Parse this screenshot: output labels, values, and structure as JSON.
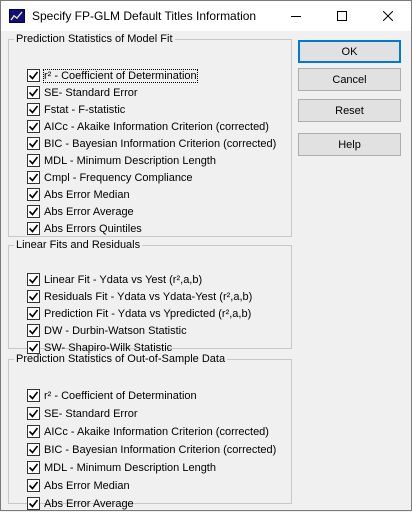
{
  "window": {
    "title": "Specify FP-GLM Default Titles Information"
  },
  "groups": {
    "model_fit": {
      "legend": "Prediction Statistics of Model Fit",
      "items": [
        {
          "label": "r² - Coefficient of Determination",
          "checked": true
        },
        {
          "label": "SE- Standard Error",
          "checked": true
        },
        {
          "label": "Fstat - F-statistic",
          "checked": true
        },
        {
          "label": "AICc - Akaike Information Criterion (corrected)",
          "checked": true
        },
        {
          "label": "BIC - Bayesian Information Criterion (corrected)",
          "checked": true
        },
        {
          "label": "MDL - Minimum Description Length",
          "checked": true
        },
        {
          "label": "Cmpl - Frequency Compliance",
          "checked": true
        },
        {
          "label": "Abs Error Median",
          "checked": true
        },
        {
          "label": "Abs Error Average",
          "checked": true
        },
        {
          "label": "Abs Errors Quintiles",
          "checked": true
        }
      ]
    },
    "linear_fits": {
      "legend": "Linear Fits and Residuals",
      "items": [
        {
          "label": "Linear Fit - Ydata vs Yest (r²,a,b)",
          "checked": true
        },
        {
          "label": "Residuals Fit - Ydata vs Ydata-Yest (r²,a,b)",
          "checked": true
        },
        {
          "label": "Prediction Fit - Ydata vs Ypredicted (r²,a,b)",
          "checked": true
        },
        {
          "label": "DW - Durbin-Watson Statistic",
          "checked": true
        },
        {
          "label": "SW- Shapiro-Wilk Statistic",
          "checked": true
        }
      ]
    },
    "out_of_sample": {
      "legend": "Prediction Statistics of Out-of-Sample Data",
      "items": [
        {
          "label": "r² - Coefficient of Determination",
          "checked": true
        },
        {
          "label": "SE- Standard Error",
          "checked": true
        },
        {
          "label": "AICc - Akaike Information Criterion (corrected)",
          "checked": true
        },
        {
          "label": "BIC - Bayesian Information Criterion (corrected)",
          "checked": true
        },
        {
          "label": "MDL - Minimum Description Length",
          "checked": true
        },
        {
          "label": "Abs Error Median",
          "checked": true
        },
        {
          "label": "Abs Error Average",
          "checked": true
        }
      ]
    }
  },
  "buttons": {
    "ok": "OK",
    "cancel": "Cancel",
    "reset": "Reset",
    "help": "Help"
  }
}
